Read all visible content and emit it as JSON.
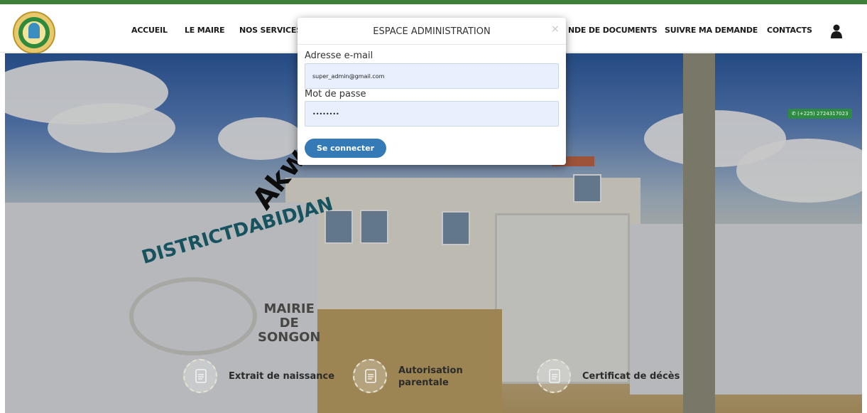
{
  "nav": {
    "items": [
      {
        "label": "ACCUEIL"
      },
      {
        "label": "LE MAIRE"
      },
      {
        "label": "NOS SERVICES"
      },
      {
        "label": "NDE DE DOCUMENTS"
      },
      {
        "label": "SUIVRE MA DEMANDE"
      },
      {
        "label": "CONTACTS"
      }
    ],
    "user_icon": "user-icon"
  },
  "hero": {
    "word": "Akwa",
    "sign_line_1": "DISTRICTDABIDJAN",
    "sign_line_2": "MAIRIE",
    "sign_line_3": "DE",
    "sign_line_4": "SONGON",
    "phone": "(+225) 2724317023"
  },
  "services": [
    {
      "label": "Extrait de naissance",
      "icon": "document-icon"
    },
    {
      "label": "Autorisation",
      "label2": "parentale",
      "icon": "document-icon"
    },
    {
      "label": "Certificat de décès",
      "icon": "document-icon"
    }
  ],
  "modal": {
    "title": "ESPACE ADMINISTRATION",
    "close": "×",
    "email_label": "Adresse e-mail",
    "email_value": "super_admin@gmail.com",
    "password_label": "Mot de passe",
    "password_value": "••••••••",
    "submit_label": "Se connecter"
  },
  "colors": {
    "primary": "#337ab7",
    "brand_green": "#3e7f3a",
    "input_bg": "#e8f0fe"
  }
}
